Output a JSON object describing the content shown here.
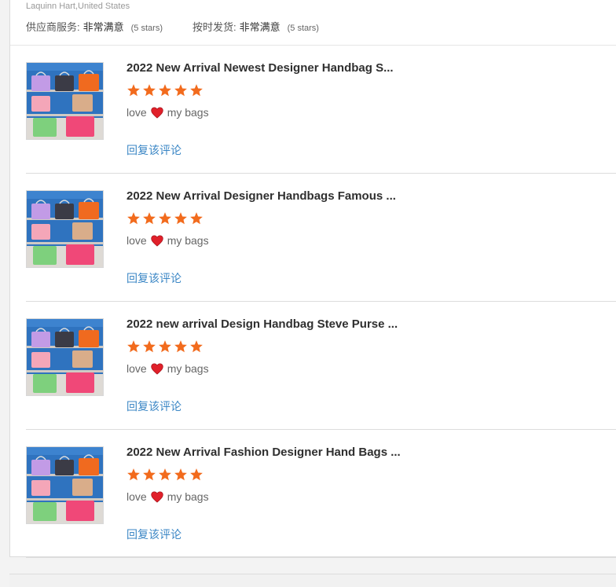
{
  "reviewer": {
    "meta": "Laquinn Hart,United States"
  },
  "ratings": [
    {
      "label": "供应商服务:",
      "value": "非常满意",
      "stars": "(5 stars)"
    },
    {
      "label": "按时发货:",
      "value": "非常满意",
      "stars": "(5 stars)"
    }
  ],
  "reviews": [
    {
      "title": "2022 New Arrival Newest Designer Handbag S...",
      "rating": 5,
      "comment_before": "love",
      "comment_emoji": "heart-icon",
      "comment_after": "my bags",
      "reply_label": "回复该评论"
    },
    {
      "title": "2022 New Arrival Designer Handbags Famous ...",
      "rating": 5,
      "comment_before": "love",
      "comment_emoji": "heart-icon",
      "comment_after": "my bags",
      "reply_label": "回复该评论"
    },
    {
      "title": "2022 new arrival Design Handbag Steve Purse ...",
      "rating": 5,
      "comment_before": "love",
      "comment_emoji": "heart-icon",
      "comment_after": "my bags",
      "reply_label": "回复该评论"
    },
    {
      "title": "2022 New Arrival Fashion Designer Hand Bags ...",
      "rating": 5,
      "comment_before": "love",
      "comment_emoji": "heart-icon",
      "comment_after": "my bags",
      "reply_label": "回复该评论"
    }
  ],
  "colors": {
    "star": "#f26b1d",
    "heart": "#e0202a",
    "reply_link": "#3a86c5",
    "thumb_background": "#2f73bf"
  }
}
